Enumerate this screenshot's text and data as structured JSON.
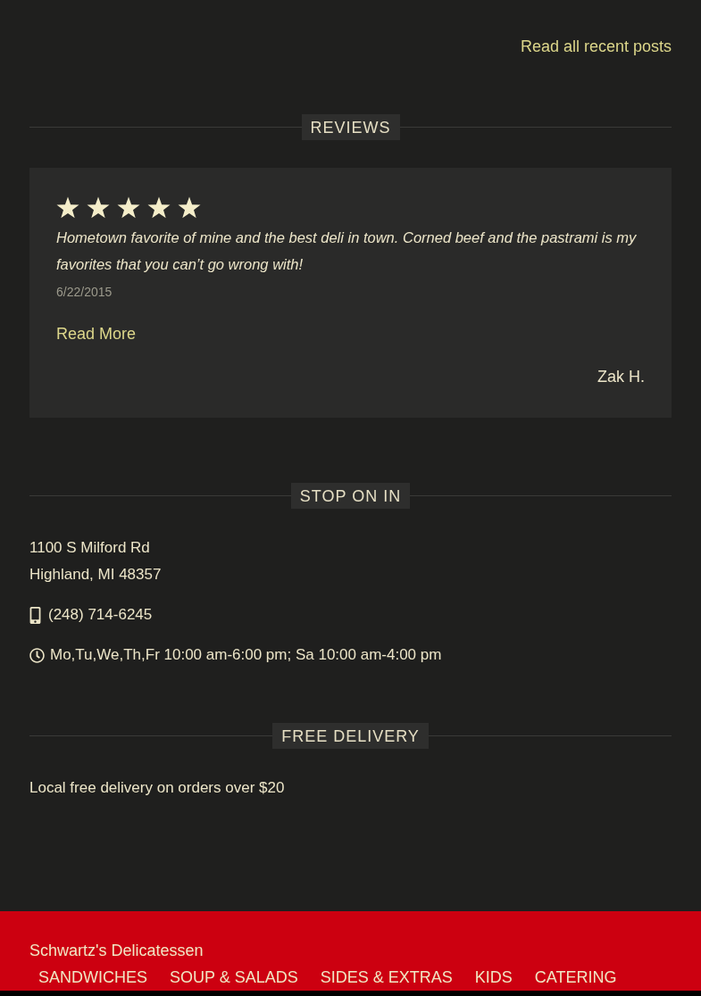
{
  "recent_posts": {
    "link": "Read all recent posts"
  },
  "reviews": {
    "heading": "REVIEWS",
    "items": [
      {
        "stars": 5,
        "quote": "Hometown favorite of mine and the best deli in town. Corned beef and the pastrami is my favorites that you can’t go wrong with!",
        "date": "6/22/2015",
        "read_more": "Read More",
        "author": "Zak H."
      }
    ]
  },
  "location": {
    "heading": "STOP ON IN",
    "address": [
      "1100 S Milford Rd",
      "Highland, MI 48357"
    ],
    "phone": "(248) 714-6245",
    "hours": "Mo,Tu,We,Th,Fr 10:00 am-6:00 pm; Sa 10:00 am-4:00 pm"
  },
  "delivery": {
    "heading": "FREE DELIVERY",
    "text": "Local free delivery on orders over $20"
  },
  "footer": {
    "title": "Schwartz's Delicatessen",
    "nav": [
      "SANDWICHES",
      "SOUP & SALADS",
      "SIDES & EXTRAS",
      "KIDS",
      "CATERING"
    ]
  }
}
